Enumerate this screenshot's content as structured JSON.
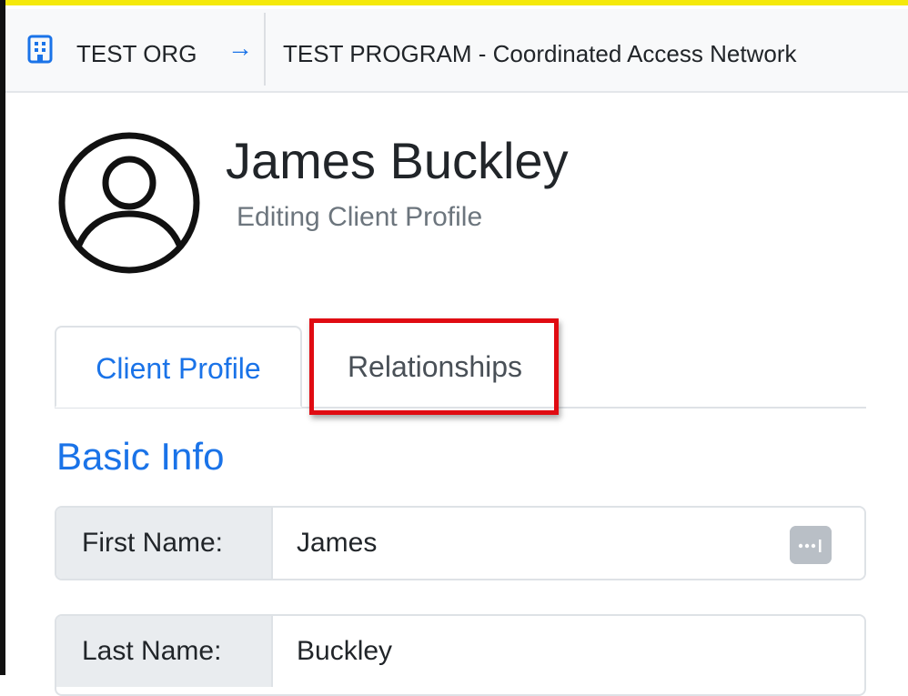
{
  "breadcrumb": {
    "org": "TEST ORG",
    "arrow": "→",
    "program": "TEST PROGRAM - Coordinated Access Network"
  },
  "client": {
    "name": "James Buckley",
    "subtitle": "Editing Client Profile"
  },
  "tabs": [
    {
      "label": "Client Profile",
      "active": true
    },
    {
      "label": "Relationships",
      "active": false,
      "highlighted": true
    }
  ],
  "section": {
    "title": "Basic Info"
  },
  "fields": {
    "first_name": {
      "label": "First Name:",
      "value": "James"
    },
    "last_name": {
      "label": "Last Name:",
      "value": "Buckley"
    }
  },
  "colors": {
    "accent": "#1a73e8",
    "highlight": "#e00b12",
    "topbar_bg": "#f8f9fa",
    "label_bg": "#e9ecef"
  },
  "icons": {
    "org": "building-icon",
    "avatar": "user-circle-icon",
    "field_action": "password-manager-icon"
  }
}
